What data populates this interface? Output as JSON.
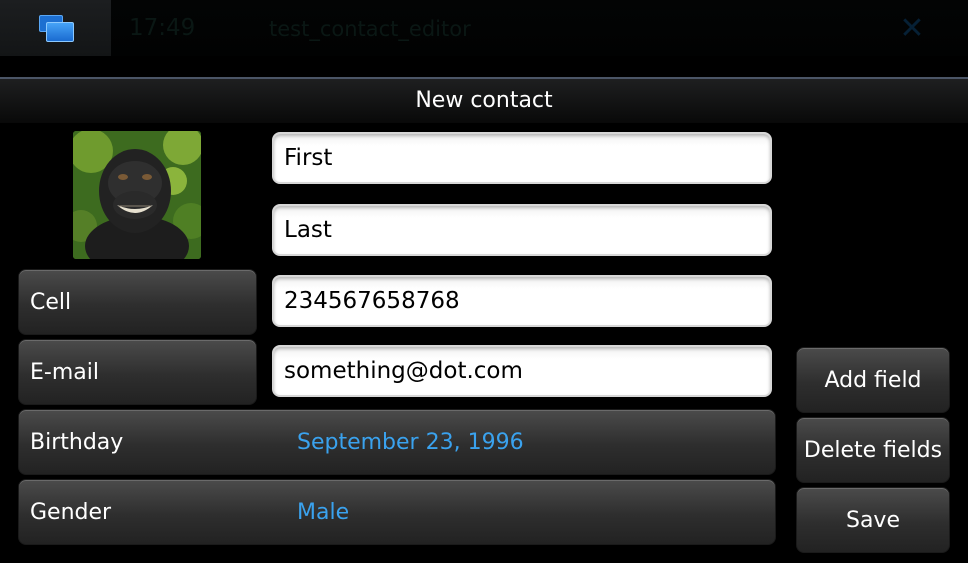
{
  "statusbar": {
    "time": "17:49",
    "app_title": "test_contact_editor"
  },
  "page": {
    "title": "New contact"
  },
  "contact": {
    "first_name": "First",
    "last_name": "Last",
    "fields": [
      {
        "label": "Cell",
        "value": "234567658768"
      },
      {
        "label": "E-mail",
        "value": "something@dot.com"
      }
    ],
    "birthday": {
      "label": "Birthday",
      "value": "September 23, 1996"
    },
    "gender": {
      "label": "Gender",
      "value": "Male"
    }
  },
  "actions": {
    "add_field": "Add field",
    "delete_fields": "Delete fields",
    "save": "Save"
  },
  "colors": {
    "accent_value": "#3aa2ee",
    "switcher_blue": "#1d6fd1"
  },
  "icons": {
    "switcher": "task-switcher-icon",
    "close": "close-icon",
    "avatar": "contact-photo"
  }
}
